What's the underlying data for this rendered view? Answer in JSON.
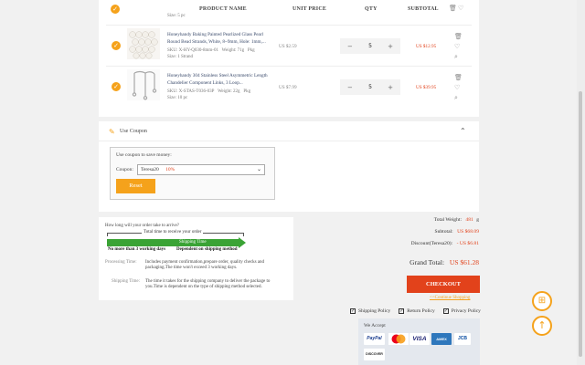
{
  "cart": {
    "columns": {
      "product": "PRODUCT NAME",
      "unit_price": "UNIT PRICE",
      "qty": "QTY",
      "subtotal": "SUBTOTAL"
    },
    "partial_row_text": "Size: 5 pc",
    "items": [
      {
        "name": "Honeyhandy Baking Painted Pearlized Glass Pearl Round Bead Strands, White, 8~9mm, Hole: 1mm,...",
        "sku": "SKU: X-HY-Q030-8mm-01",
        "weight": "Weight: 71g",
        "unit": "Pkg",
        "size": "Size: 1 Strand",
        "price": "US $2.59",
        "qty": "5",
        "subtotal": "US $12.95"
      },
      {
        "name": "Honeyhandy 304 Stainless Steel Asymmetric Length Chandelier Component Links, 3 Loop...",
        "sku": "SKU: X-STAS-T036-03P",
        "weight": "Weight: 22g",
        "unit": "Pkg",
        "size": "Size: 10 pc",
        "price": "US $7.99",
        "qty": "5",
        "subtotal": "US $39.95"
      }
    ]
  },
  "coupon": {
    "title": "Use Coupon",
    "prompt": "Use coupon to save money:",
    "label": "Coupon:",
    "selected_code": "Teresa20",
    "selected_discount": "10%",
    "reset_label": "Reset"
  },
  "shipping_info": {
    "question": "How long will your order take to arrive?",
    "total_time": "Total time to receive your order",
    "processing_label": "Processing Time",
    "shipping_label": "Shipping Time",
    "processing_note": "No more than 3 working days",
    "shipping_note": "Dependent on shipping method",
    "processing_title": "Processing Time:",
    "processing_desc": "Includes payment confirmation,prepare order, quality checks and packaging.The time won't exceed 3 working days.",
    "shipping_title": "Shipping Time:",
    "shipping_desc": "The time it takes for the shipping company to deliver the package to you.Time is dependent on the type of shipping method selected."
  },
  "totals": {
    "weight_label": "Total Weight:",
    "weight_value": "481",
    "weight_unit": "g",
    "subtotal_label": "Subtotal:",
    "subtotal_value": "US $68.09",
    "discount_label": "Discount(Teresa20):",
    "discount_value": "- US $6.81",
    "grand_label": "Grand Total:",
    "grand_value": "US $61.28",
    "checkout_label": "CHECKOUT",
    "continue_label": "<<Continue Shopping"
  },
  "policies": [
    "Shipping Policy",
    "Return Policy",
    "Privacy Policy"
  ],
  "we_accept": "We Accept",
  "payment_methods": [
    "PayPal",
    "Mastercard",
    "VISA",
    "AMEX",
    "JCB",
    "DISCOVER"
  ],
  "colors": {
    "accent": "#f5a21b",
    "price_red": "#e2421b",
    "green": "#3aa335"
  },
  "icons": [
    "check-icon",
    "trash-icon",
    "heart-icon",
    "search-icon",
    "coupon-icon",
    "chevron-up-icon",
    "gift-icon",
    "arrow-up-icon"
  ]
}
